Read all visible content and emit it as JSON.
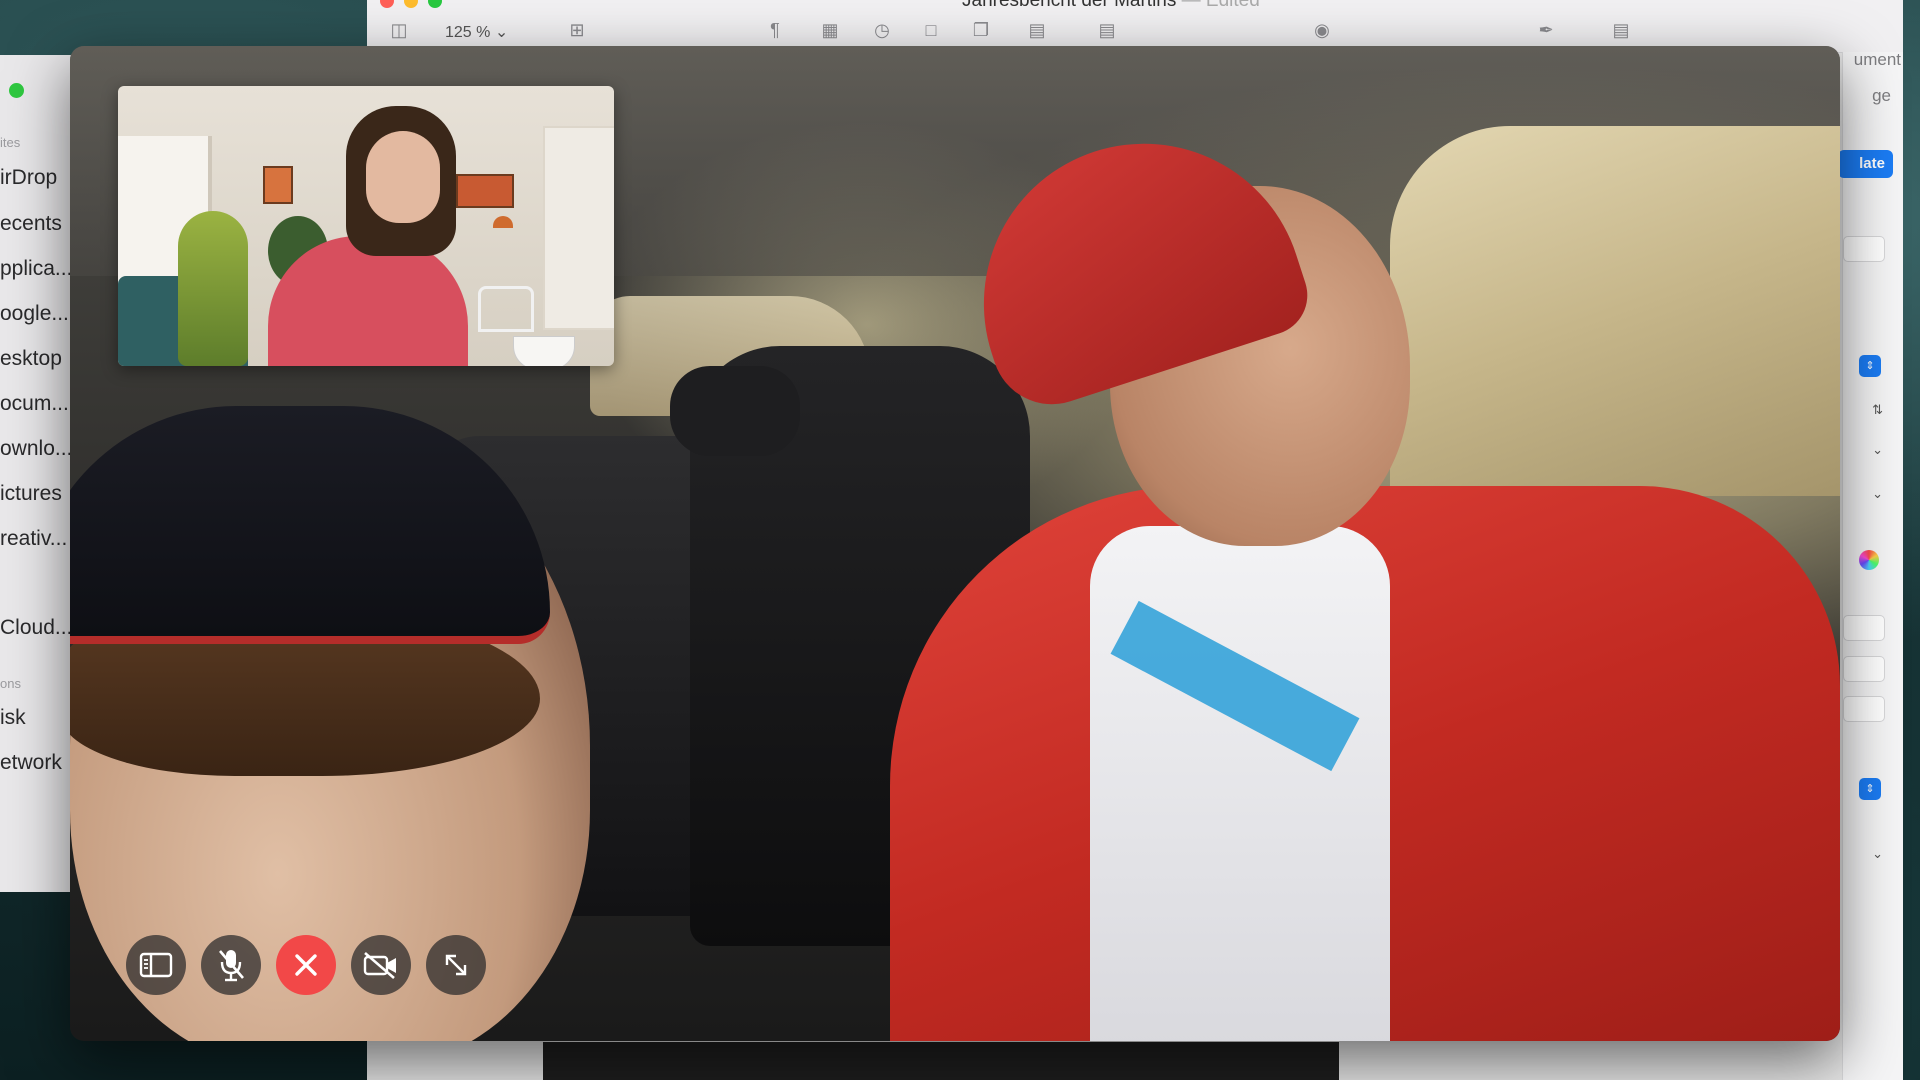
{
  "finder": {
    "sidebar_items": [
      {
        "label": "ites",
        "kind": "section"
      },
      {
        "label": "irDrop",
        "kind": "item"
      },
      {
        "label": "ecents",
        "kind": "item"
      },
      {
        "label": "pplica...",
        "kind": "item"
      },
      {
        "label": "oogle...",
        "kind": "item"
      },
      {
        "label": "esktop",
        "kind": "item"
      },
      {
        "label": "ocum...",
        "kind": "item"
      },
      {
        "label": "ownlo...",
        "kind": "item"
      },
      {
        "label": "ictures",
        "kind": "item"
      },
      {
        "label": "reativ...",
        "kind": "item"
      },
      {
        "label": "Cloud...",
        "kind": "item"
      },
      {
        "label": "ons",
        "kind": "section"
      },
      {
        "label": "isk",
        "kind": "item"
      },
      {
        "label": "etwork",
        "kind": "item"
      }
    ]
  },
  "pages": {
    "title": "Jahresbericht der Martins",
    "title_suffix": "— Edited",
    "zoom": "125 %",
    "inspector": {
      "tab_label": "ument",
      "sub_label": "ge",
      "update_button": "late"
    },
    "toolbar_icons": [
      "sidebar-icon",
      "add-page-icon",
      "paragraph-icon",
      "table-icon",
      "chart-icon",
      "text-box-icon",
      "shape-icon",
      "media-icon",
      "comment-icon",
      "collaborate-icon",
      "format-icon",
      "document-icon"
    ]
  },
  "facetime": {
    "controls": [
      {
        "name": "sidebar-toggle-button",
        "icon": "sidebar-icon"
      },
      {
        "name": "mute-button",
        "icon": "microphone-slash-icon"
      },
      {
        "name": "end-call-button",
        "icon": "close-icon"
      },
      {
        "name": "camera-off-button",
        "icon": "video-slash-icon"
      },
      {
        "name": "fullscreen-button",
        "icon": "expand-icon"
      }
    ],
    "colors": {
      "end_call": "#f24848",
      "control_bg": "rgba(40,40,42,0.72)"
    }
  }
}
